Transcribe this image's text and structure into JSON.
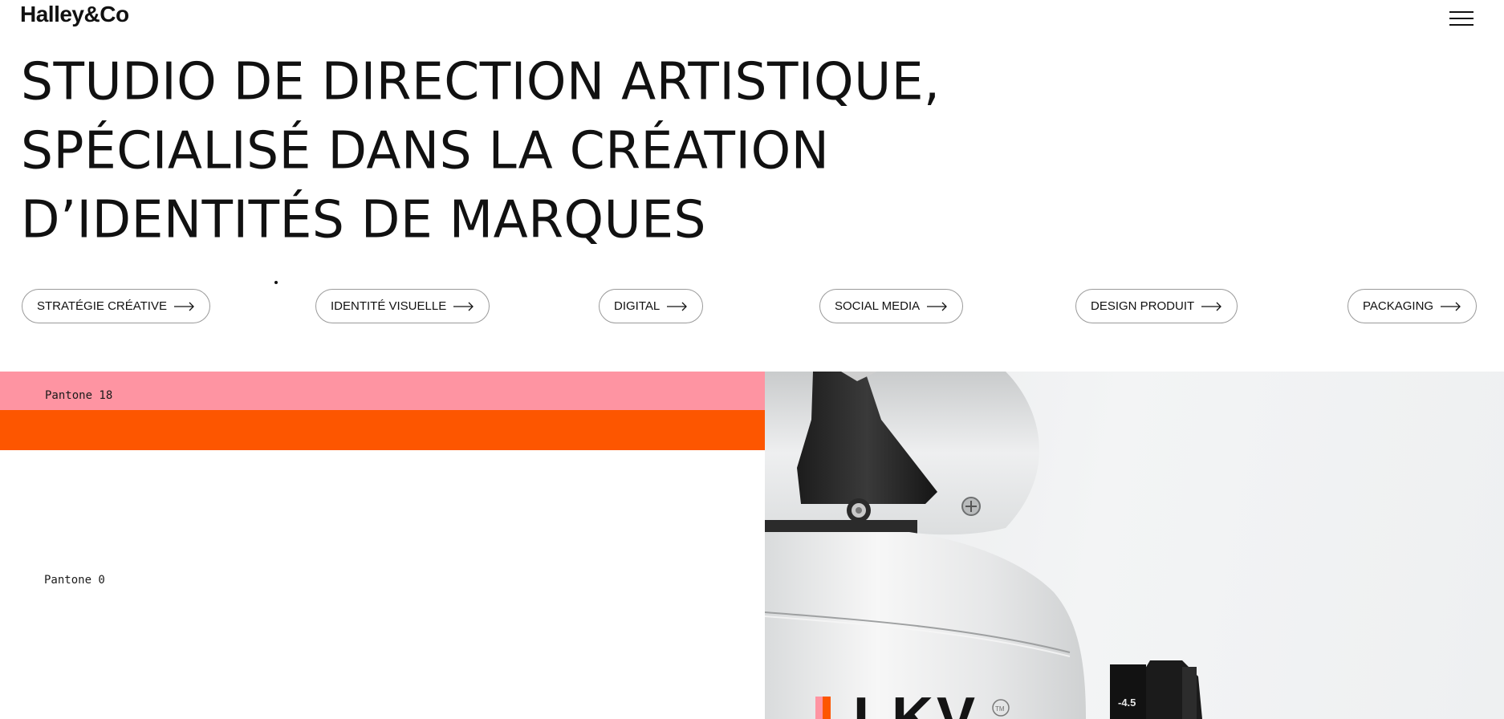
{
  "header": {
    "logo": "Halley&Co",
    "menu_icon": "hamburger-menu-icon"
  },
  "hero": {
    "lines": [
      "STUDIO DE DIRECTION ARTISTIQUE,",
      "SPÉCIALISÉ DANS LA CRÉATION",
      "D’IDENTITÉS DE MARQUES"
    ]
  },
  "services": [
    {
      "label": "STRATÉGIE CRÉATIVE",
      "icon": "arrow-right-icon"
    },
    {
      "label": "IDENTITÉ VISUELLE",
      "icon": "arrow-right-icon"
    },
    {
      "label": "DIGITAL",
      "icon": "arrow-right-icon"
    },
    {
      "label": "SOCIAL MEDIA",
      "icon": "arrow-right-icon"
    },
    {
      "label": "DESIGN PRODUIT",
      "icon": "arrow-right-icon"
    },
    {
      "label": "PACKAGING",
      "icon": "arrow-right-icon"
    }
  ],
  "swatches": {
    "top_label": "Pantone 18",
    "bottom_label": "Pantone 0",
    "pink": "#fe94a2",
    "orange": "#fd5600"
  },
  "product_image": {
    "visible_text": "LKV",
    "trademark": "TM",
    "dial_mark": "-4.5"
  }
}
